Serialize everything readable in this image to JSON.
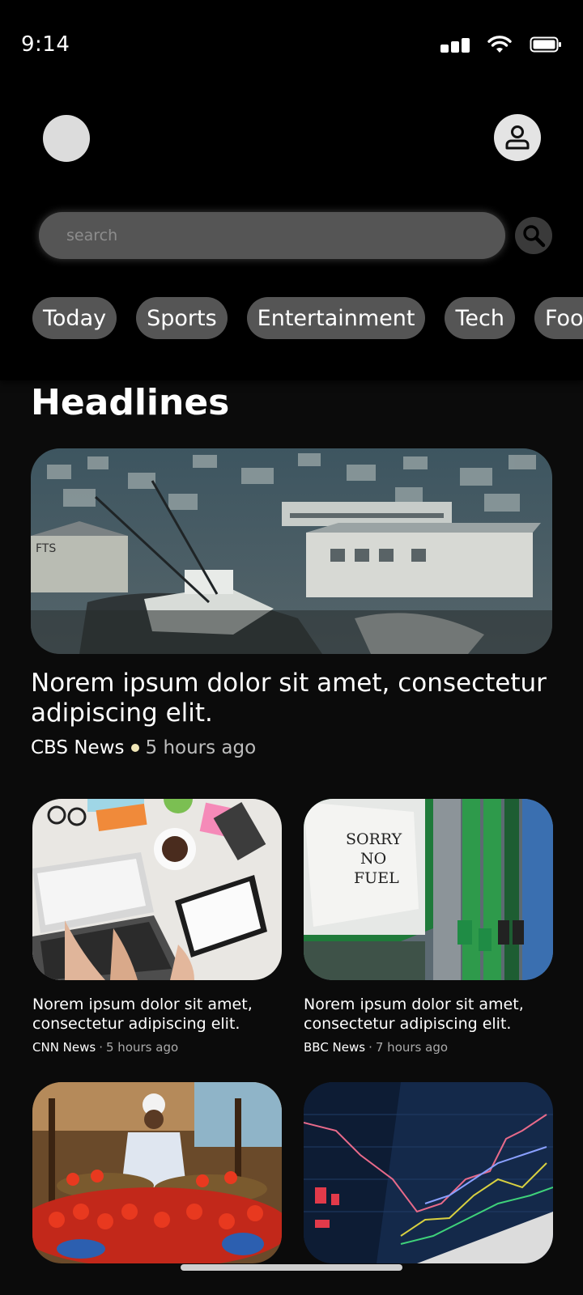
{
  "status_bar": {
    "time": "9:14"
  },
  "search": {
    "placeholder": "search"
  },
  "categories": [
    "Today",
    "Sports",
    "Entertainment",
    "Tech",
    "Food"
  ],
  "section_title": "Headlines",
  "hero": {
    "title": "Norem ipsum dolor sit amet, consectetur adipiscing elit.",
    "source": "CBS News",
    "time": "5 hours ago"
  },
  "cards": [
    {
      "title": "Norem ipsum dolor sit amet, consectetur adipiscing elit.",
      "source": "CNN News",
      "time": "5 hours ago"
    },
    {
      "title": "Norem ipsum dolor sit amet, consectetur adipiscing elit.",
      "source": "BBC News",
      "time": "7 hours ago"
    }
  ],
  "image_text": {
    "fuel_sign": "SORRY NO FUEL",
    "store_sign": "FTS"
  },
  "colors": {
    "background": "#0b0b0b",
    "chip": "#555555",
    "accent_dot": "#f1e7b8"
  }
}
